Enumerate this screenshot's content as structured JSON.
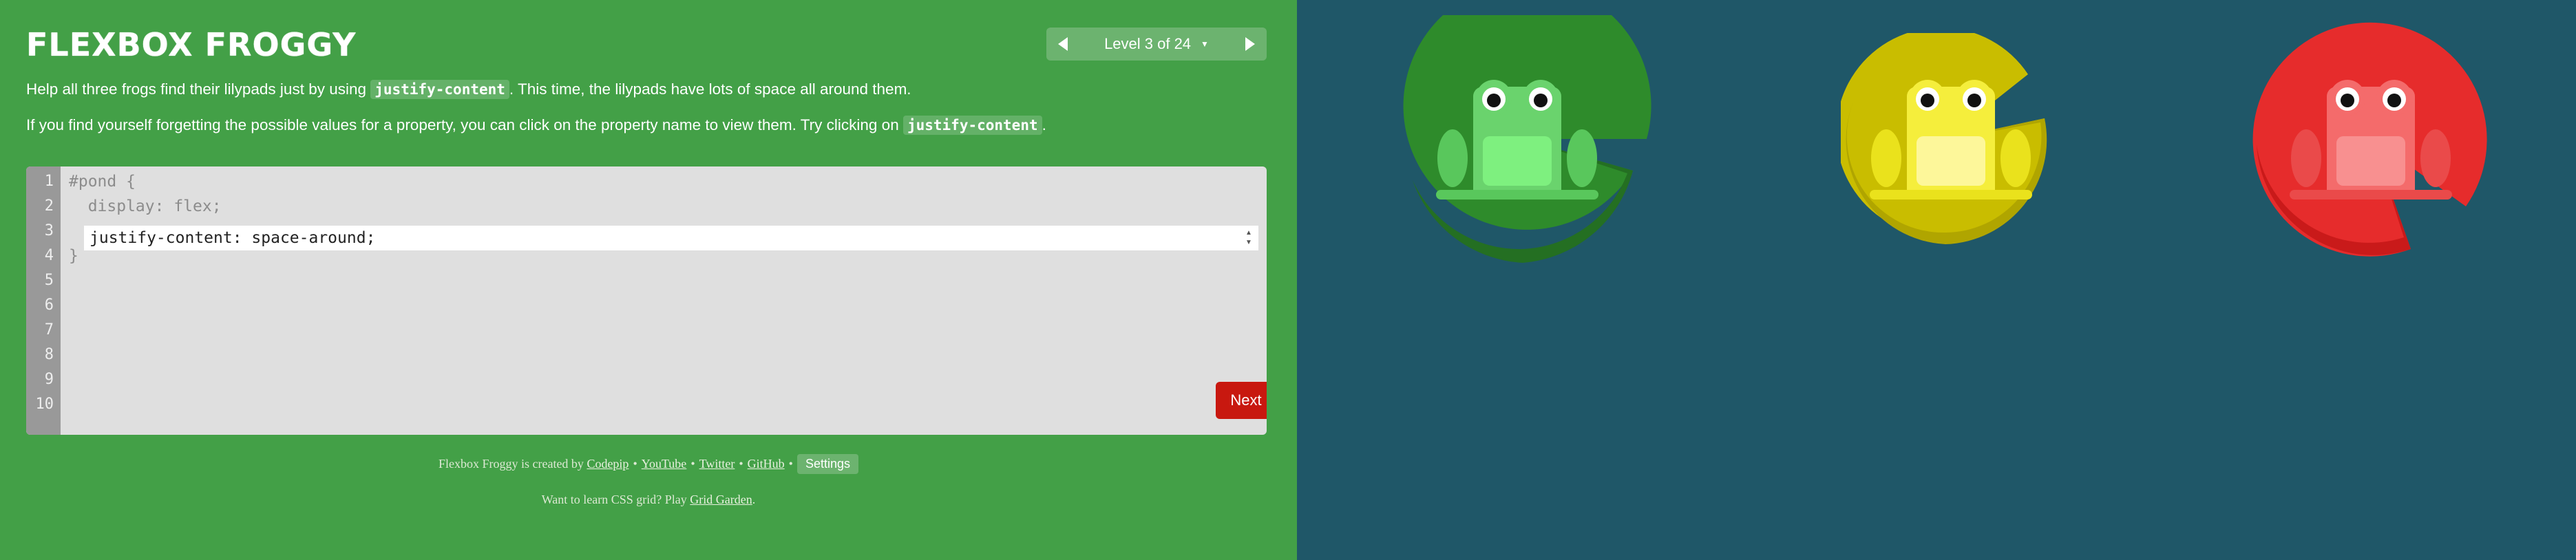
{
  "header": {
    "title": "FLEXBOX FROGGY"
  },
  "level": {
    "text": "Level 3 of 24",
    "caret": "▼"
  },
  "instructions": {
    "line1_before": "Help all three frogs find their lilypads just by using ",
    "line1_code": "justify-content",
    "line1_after": ". This time, the lilypads have lots of space all around them.",
    "line2_before": "If you find yourself forgetting the possible values for a property, you can click on the property name to view them. Try clicking on ",
    "line2_code": "justify-content",
    "line2_after": "."
  },
  "editor": {
    "line_numbers": [
      "1",
      "2",
      "3",
      "4",
      "5",
      "6",
      "7",
      "8",
      "9",
      "10"
    ],
    "line1": "#pond {",
    "line2": "  display: flex;",
    "input_value": "justify-content: space-around;",
    "line4": "}",
    "next_label": "Next"
  },
  "footer": {
    "credit_prefix": "Flexbox Froggy is created by ",
    "links": [
      "Codepip",
      "YouTube",
      "Twitter",
      "GitHub"
    ],
    "separator": "•",
    "settings_label": "Settings",
    "grid_prefix": "Want to learn CSS grid? Play ",
    "grid_link": "Grid Garden",
    "grid_suffix": "."
  },
  "frogs": [
    {
      "color": "green",
      "pad": "#2e8b2b",
      "pad_light": "#43a047",
      "body": "#6ad36d",
      "belly": "#7ef07f",
      "legs": "#59c75c"
    },
    {
      "color": "yellow",
      "pad": "#c9bd00",
      "pad_light": "#e0d619",
      "body": "#f5ee3c",
      "belly": "#fdf79a",
      "legs": "#eae21c"
    },
    {
      "color": "red",
      "pad": "#c91a1a",
      "pad_light": "#e62c2c",
      "body": "#f46b6b",
      "belly": "#f89090",
      "legs": "#ea4a4a"
    }
  ]
}
